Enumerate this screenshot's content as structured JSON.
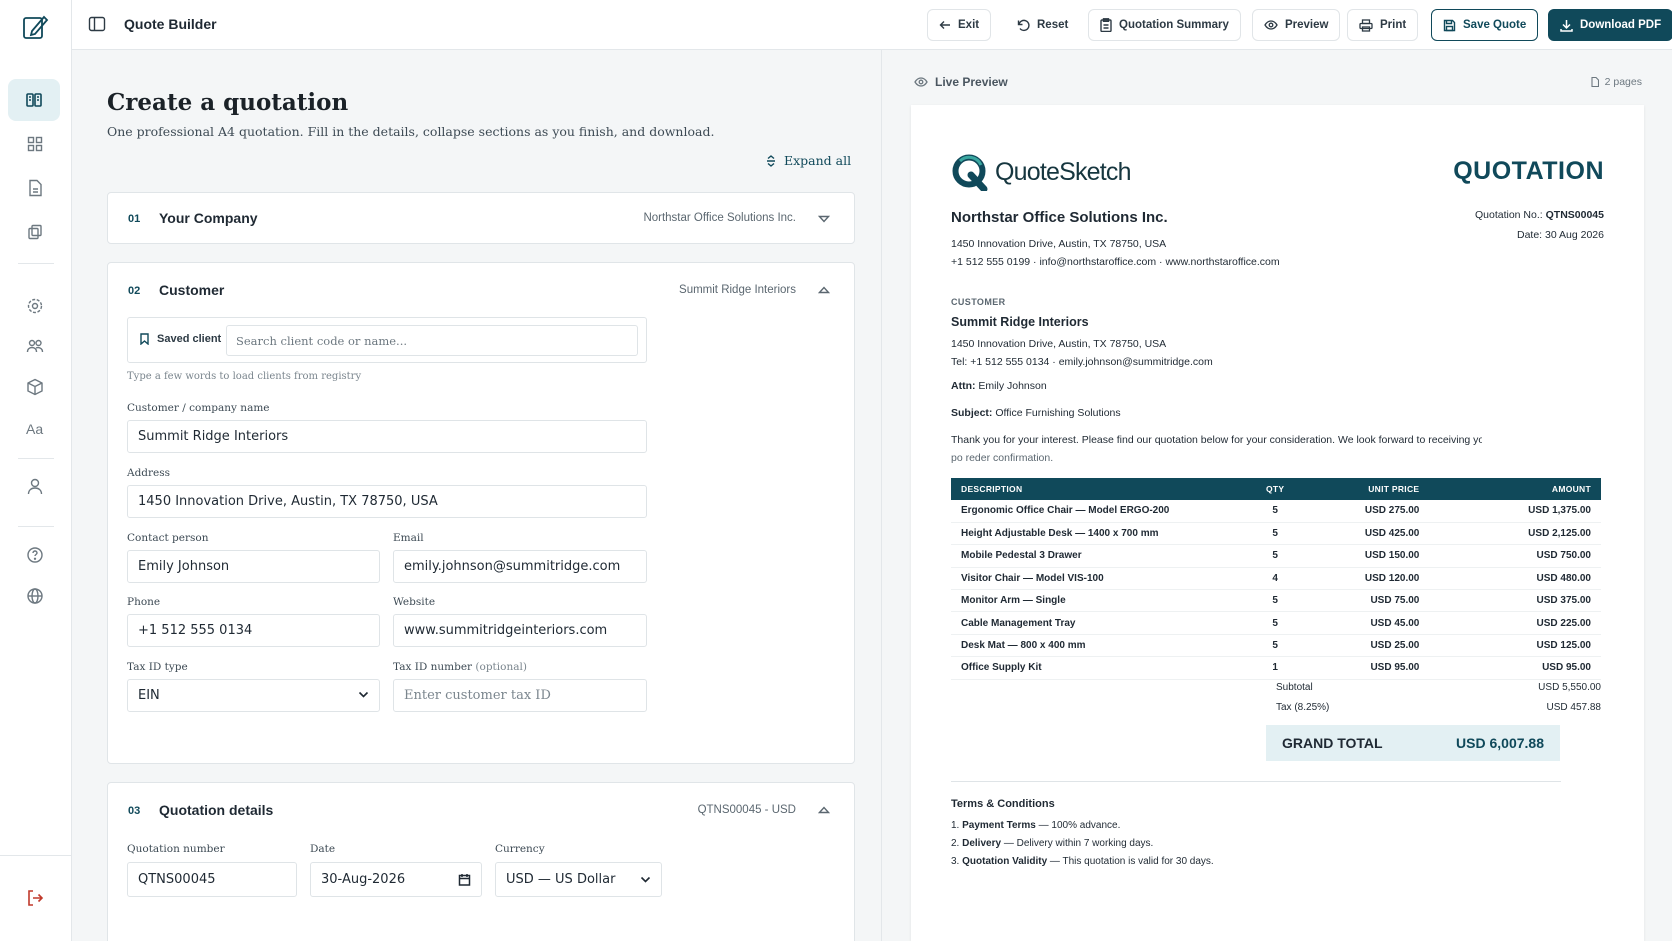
{
  "app": {
    "title": "Quote Builder"
  },
  "toolbar": {
    "exit": "Exit",
    "reset": "Reset",
    "summary": "Quotation Summary",
    "preview": "Preview",
    "print": "Print",
    "save": "Save Quote",
    "download": "Download PDF"
  },
  "form": {
    "title": "Create a quotation",
    "subtitle": "One professional A4 quotation. Fill in the details, collapse sections as you finish, and download.",
    "expand_all": "Expand all",
    "sections": [
      {
        "num": "01",
        "title": "Your Company",
        "meta": "Northstar Office Solutions Inc."
      },
      {
        "num": "02",
        "title": "Customer",
        "meta": "Summit Ridge Interiors"
      },
      {
        "num": "03",
        "title": "Quotation details",
        "meta": "QTNS00045 - USD"
      }
    ],
    "customer": {
      "saved_client_label": "Saved client",
      "search_placeholder": "Search client code or name...",
      "hint": "Type a few words to load clients from registry",
      "name_label": "Customer / company name",
      "name": "Summit Ridge Interiors",
      "address_label": "Address",
      "address": "1450 Innovation Drive, Austin, TX 78750, USA",
      "contact_label": "Contact person",
      "contact": "Emily Johnson",
      "email_label": "Email",
      "email": "emily.johnson@summitridge.com",
      "phone_label": "Phone",
      "phone": "+1 512 555 0134",
      "website_label": "Website",
      "website": "www.summitridgeinteriors.com",
      "taxtype_label": "Tax ID type",
      "taxtype": "EIN",
      "taxnum_label": "Tax ID number",
      "taxnum_optional": "(optional)",
      "taxnum_placeholder": "Enter customer tax ID"
    },
    "details": {
      "qnum_label": "Quotation number",
      "qnum": "QTNS00045",
      "date_label": "Date",
      "date": "30-Aug-2026",
      "currency_label": "Currency",
      "currency": "USD — US Dollar"
    }
  },
  "preview": {
    "label": "Live Preview",
    "pages": "2 pages",
    "brand": "QuoteSketch",
    "doc_title": "QUOTATION",
    "company": {
      "name": "Northstar Office Solutions Inc.",
      "address": "1450 Innovation Drive, Austin, TX 78750, USA",
      "contact": "+1 512 555 0199  ·  info@northstaroffice.com  ·  www.northstaroffice.com"
    },
    "qno_label": "Quotation No.:",
    "qno": "QTNS00045",
    "date_line": "Date: 30 Aug 2026",
    "customer_heading": "CUSTOMER",
    "customer": {
      "name": "Summit Ridge Interiors",
      "address": "1450 Innovation Drive, Austin, TX 78750, USA",
      "contact": "Tel: +1 512 555 0134  ·  emily.johnson@summitridge.com"
    },
    "attn_label": "Attn:",
    "attn": "Emily Johnson",
    "subject_label": "Subject:",
    "subject": "Office Furnishing Solutions",
    "intro_1": "Thank you for your interest. Please find our quotation below for your consideration. We look forward to receiving yo",
    "intro_2": "po reder confirmation.",
    "columns": [
      "DESCRIPTION",
      "QTY",
      "UNIT PRICE",
      "AMOUNT"
    ],
    "items": [
      {
        "desc": "Ergonomic Office Chair — Model ERGO-200",
        "qty": "5",
        "unit": "USD 275.00",
        "amount": "USD 1,375.00"
      },
      {
        "desc": "Height Adjustable Desk — 1400 x 700 mm",
        "qty": "5",
        "unit": "USD 425.00",
        "amount": "USD 2,125.00"
      },
      {
        "desc": "Mobile Pedestal 3 Drawer",
        "qty": "5",
        "unit": "USD 150.00",
        "amount": "USD 750.00"
      },
      {
        "desc": "Visitor Chair — Model VIS-100",
        "qty": "4",
        "unit": "USD 120.00",
        "amount": "USD 480.00"
      },
      {
        "desc": "Monitor Arm — Single",
        "qty": "5",
        "unit": "USD 75.00",
        "amount": "USD 375.00"
      },
      {
        "desc": "Cable Management Tray",
        "qty": "5",
        "unit": "USD 45.00",
        "amount": "USD 225.00"
      },
      {
        "desc": "Desk Mat — 800 x 400 mm",
        "qty": "5",
        "unit": "USD 25.00",
        "amount": "USD 125.00"
      },
      {
        "desc": "Office Supply Kit",
        "qty": "1",
        "unit": "USD 95.00",
        "amount": "USD 95.00"
      }
    ],
    "subtotal_label": "Subtotal",
    "subtotal": "USD 5,550.00",
    "tax_label": "Tax (8.25%)",
    "tax": "USD 457.88",
    "grand_label": "GRAND TOTAL",
    "grand": "USD 6,007.88",
    "terms_title": "Terms & Conditions",
    "terms": [
      {
        "n": "1.",
        "b": "Payment Terms",
        "t": " — 100% advance."
      },
      {
        "n": "2.",
        "b": "Delivery",
        "t": " — Delivery within 7 working days."
      },
      {
        "n": "3.",
        "b": "Quotation Validity",
        "t": " — This quotation is valid for 30 days."
      }
    ]
  },
  "colors": {
    "accent": "#10495a",
    "accent_light": "#e3f0f3",
    "logout": "#c0392b"
  }
}
